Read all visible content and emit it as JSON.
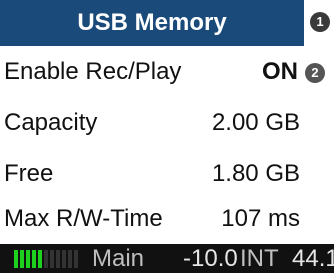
{
  "header": {
    "title": "USB Memory"
  },
  "knobs": {
    "k1": "1",
    "k2": "2"
  },
  "rows": [
    {
      "label": "Enable Rec/Play",
      "value": "ON"
    },
    {
      "label": "Capacity",
      "value": "2.00 GB"
    },
    {
      "label": "Free",
      "value": "1.80 GB"
    },
    {
      "label": "Max R/W-Time",
      "value": "107 ms"
    }
  ],
  "status": {
    "meter_level": 0.45,
    "main": "Main",
    "level": "-10.0",
    "clock": "INT",
    "rate": "44.1"
  },
  "colors": {
    "header_bg": "#1a4a7a",
    "meter_on": "#1fd11f"
  }
}
